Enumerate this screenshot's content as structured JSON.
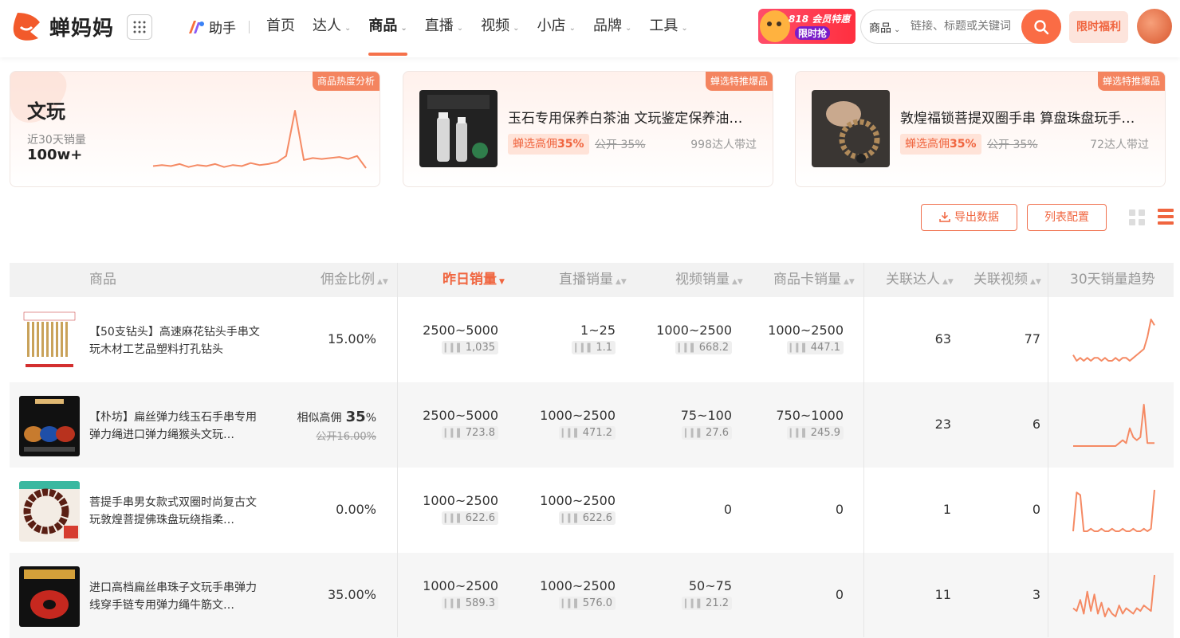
{
  "header": {
    "logo_text": "蝉妈妈",
    "assistant_label": "助手",
    "nav": [
      {
        "label": "首页"
      },
      {
        "label": "达人"
      },
      {
        "label": "商品"
      },
      {
        "label": "直播"
      },
      {
        "label": "视频"
      },
      {
        "label": "小店"
      },
      {
        "label": "品牌"
      },
      {
        "label": "工具"
      }
    ],
    "active_nav": "商品",
    "promo": {
      "line1": "818 会员特惠",
      "line2": "限时抢"
    },
    "search": {
      "scope": "商品",
      "placeholder": "链接、标题或关键词"
    },
    "limit_button": "限时福利",
    "colors": {
      "accent": "#f5714a",
      "primary_text": "#222222"
    }
  },
  "cards": {
    "trend_card": {
      "tag": "商品热度分析",
      "title": "文玩",
      "label": "近30天销量",
      "value": "100w+",
      "trend_values": [
        20,
        21,
        20,
        22,
        19,
        21,
        20,
        22,
        19,
        21,
        20,
        23,
        21,
        22,
        24,
        30,
        75,
        26,
        28,
        27,
        28,
        29,
        27,
        30,
        18
      ]
    },
    "promo_cards": [
      {
        "tag": "蝉选特推爆品",
        "title": "玉石专用保养白茶油 文玩鉴定保养油…",
        "badge_prefix": "蝉选高佣",
        "badge_value": "35%",
        "original": "公开 35%",
        "count": "998达人带过"
      },
      {
        "tag": "蝉选特推爆品",
        "title": "敦煌福锁菩提双圈手串 算盘珠盘玩手…",
        "badge_prefix": "蝉选高佣",
        "badge_value": "35%",
        "original": "公开 35%",
        "count": "72达人带过"
      }
    ]
  },
  "toolbar": {
    "export_label": "导出数据",
    "config_label": "列表配置"
  },
  "table": {
    "headers": {
      "product": "商品",
      "commission": "佣金比例",
      "yesterday": "昨日销量",
      "live": "直播销量",
      "video": "视频销量",
      "card": "商品卡销量",
      "kols": "关联达人",
      "videos": "关联视频",
      "trend": "30天销量趋势"
    },
    "rows": [
      {
        "name": "【50支钻头】高速麻花钻头手串文玩木材工艺品塑料打孔钻头",
        "commission": "15.00%",
        "commission_prefix": "",
        "commission_strike": "",
        "yesterday": "2500~5000",
        "yesterday_sub": "1,035",
        "live": "1~25",
        "live_sub": "1.1",
        "video": "1000~2500",
        "video_sub": "668.2",
        "card": "1000~2500",
        "card_sub": "447.1",
        "kols": "63",
        "videos": "77",
        "trend": [
          8,
          6,
          7,
          6,
          7,
          6,
          7,
          7,
          6,
          7,
          6,
          6,
          7,
          6,
          7,
          7,
          6,
          7,
          8,
          9,
          10,
          14,
          20,
          18
        ]
      },
      {
        "name": "【朴坊】扁丝弹力线玉石手串专用弹力绳进口弹力绳猴头文玩…",
        "commission": "%",
        "commission_prefix": "相似高佣",
        "commission_highlight": "35",
        "commission_strike": "公开16.00%",
        "yesterday": "2500~5000",
        "yesterday_sub": "723.8",
        "live": "1000~2500",
        "live_sub": "471.2",
        "video": "75~100",
        "video_sub": "27.6",
        "card": "750~1000",
        "card_sub": "245.9",
        "kols": "23",
        "videos": "6",
        "trend": [
          2,
          2,
          2,
          2,
          2,
          2,
          2,
          2,
          2,
          2,
          2,
          2,
          2,
          3,
          4,
          3,
          8,
          5,
          4,
          5,
          16,
          3,
          3,
          3
        ]
      },
      {
        "name": "菩提手串男女款式双圈时尚复古文玩敦煌菩提佛珠盘玩绕指柔…",
        "commission": "0.00%",
        "commission_prefix": "",
        "commission_strike": "",
        "yesterday": "1000~2500",
        "yesterday_sub": "622.6",
        "live": "1000~2500",
        "live_sub": "622.6",
        "video": "0",
        "video_sub": "",
        "card": "0",
        "card_sub": "",
        "kols": "1",
        "videos": "0",
        "trend": [
          3,
          18,
          17,
          3,
          3,
          4,
          3,
          3,
          4,
          3,
          3,
          4,
          3,
          3,
          4,
          3,
          3,
          4,
          3,
          3,
          4,
          3,
          4,
          19
        ]
      },
      {
        "name": "进口高档扁丝串珠子文玩手串弹力线穿手链专用弹力绳牛筋文…",
        "commission": "35.00%",
        "commission_prefix": "",
        "commission_strike": "",
        "yesterday": "1000~2500",
        "yesterday_sub": "589.3",
        "live": "1000~2500",
        "live_sub": "576.0",
        "video": "50~75",
        "video_sub": "21.2",
        "card": "0",
        "card_sub": "",
        "kols": "11",
        "videos": "3",
        "trend": [
          6,
          5,
          9,
          4,
          12,
          5,
          11,
          4,
          8,
          3,
          6,
          4,
          3,
          7,
          4,
          6,
          5,
          4,
          6,
          5,
          7,
          6,
          5,
          18
        ]
      }
    ]
  }
}
